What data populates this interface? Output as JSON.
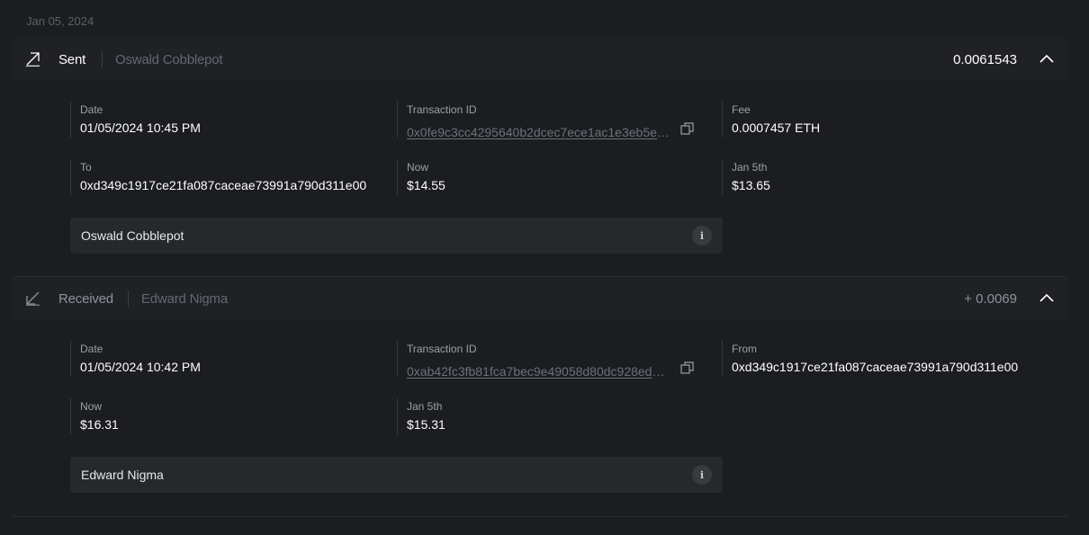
{
  "date_group": "Jan 05, 2024",
  "transactions": [
    {
      "direction": "Sent",
      "direction_icon": "arrow-up-right-icon",
      "counterparty": "Oswald Cobblepot",
      "amount": "0.0061543",
      "expanded": true,
      "fields": {
        "date_label": "Date",
        "date_value": "01/05/2024 10:45 PM",
        "txid_label": "Transaction ID",
        "txid_value": "0x0fe9c3cc4295640b2dcec7ece1ac1e3eb5e8…",
        "third_label": "Fee",
        "third_value": "0.0007457 ETH",
        "party_label": "To",
        "party_value": "0xd349c1917ce21fa087caceae73991a790d311e00",
        "now_label": "Now",
        "now_value": "$14.55",
        "then_label": "Jan 5th",
        "then_value": "$13.65"
      },
      "note": "Oswald Cobblepot"
    },
    {
      "direction": "Received",
      "direction_icon": "arrow-down-left-icon",
      "counterparty": "Edward Nigma",
      "amount": "+ 0.0069",
      "expanded": true,
      "fields": {
        "date_label": "Date",
        "date_value": "01/05/2024 10:42 PM",
        "txid_label": "Transaction ID",
        "txid_value": "0xab42fc3fb81fca7bec9e49058d80dc928ed5…",
        "third_label": "From",
        "third_value": "0xd349c1917ce21fa087caceae73991a790d311e00",
        "now_label": "Now",
        "now_value": "$16.31",
        "then_label": "Jan 5th",
        "then_value": "$15.31"
      },
      "note": "Edward Nigma"
    }
  ],
  "icons": {
    "copy": "copy-icon",
    "info": "info-icon",
    "chevron": "chevron-up-icon"
  },
  "colors": {
    "background": "#1b1d20",
    "header": "#1f2124",
    "muted_text": "#8b93a0",
    "note_bg": "#26282c"
  }
}
